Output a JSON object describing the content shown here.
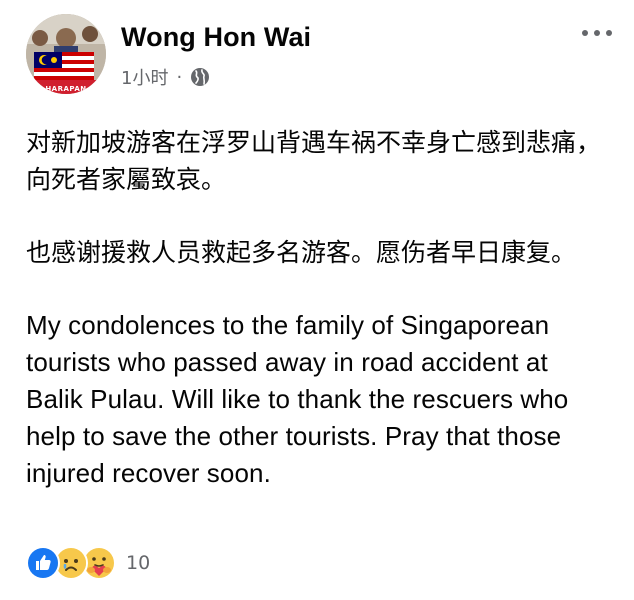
{
  "post": {
    "author": "Wong Hon Wai",
    "timestamp": "1小时",
    "separator": "·",
    "privacy_icon": "globe-icon",
    "more_icon": "more-horizontal-icon",
    "avatar_badge": "HARAPAN",
    "paragraphs": {
      "zh1": "对新加坡游客在浮罗山背遇车祸不幸身亡感到悲痛，向死者家屬致哀。",
      "zh2": "也感谢援救人员救起多名游客。愿伤者早日康复。",
      "en": "My condolences to the family of Singaporean tourists who passed away in road accident at Balik Pulau. Will like to thank the rescuers who help to save the other tourists. Pray that those injured recover soon."
    },
    "reactions": {
      "types": [
        "like",
        "sad",
        "care"
      ],
      "count": "10"
    }
  },
  "colors": {
    "text_primary": "#050505",
    "text_secondary": "#65676b",
    "like_blue": "#1877f2",
    "emoji_yellow": "#f7c84b"
  }
}
